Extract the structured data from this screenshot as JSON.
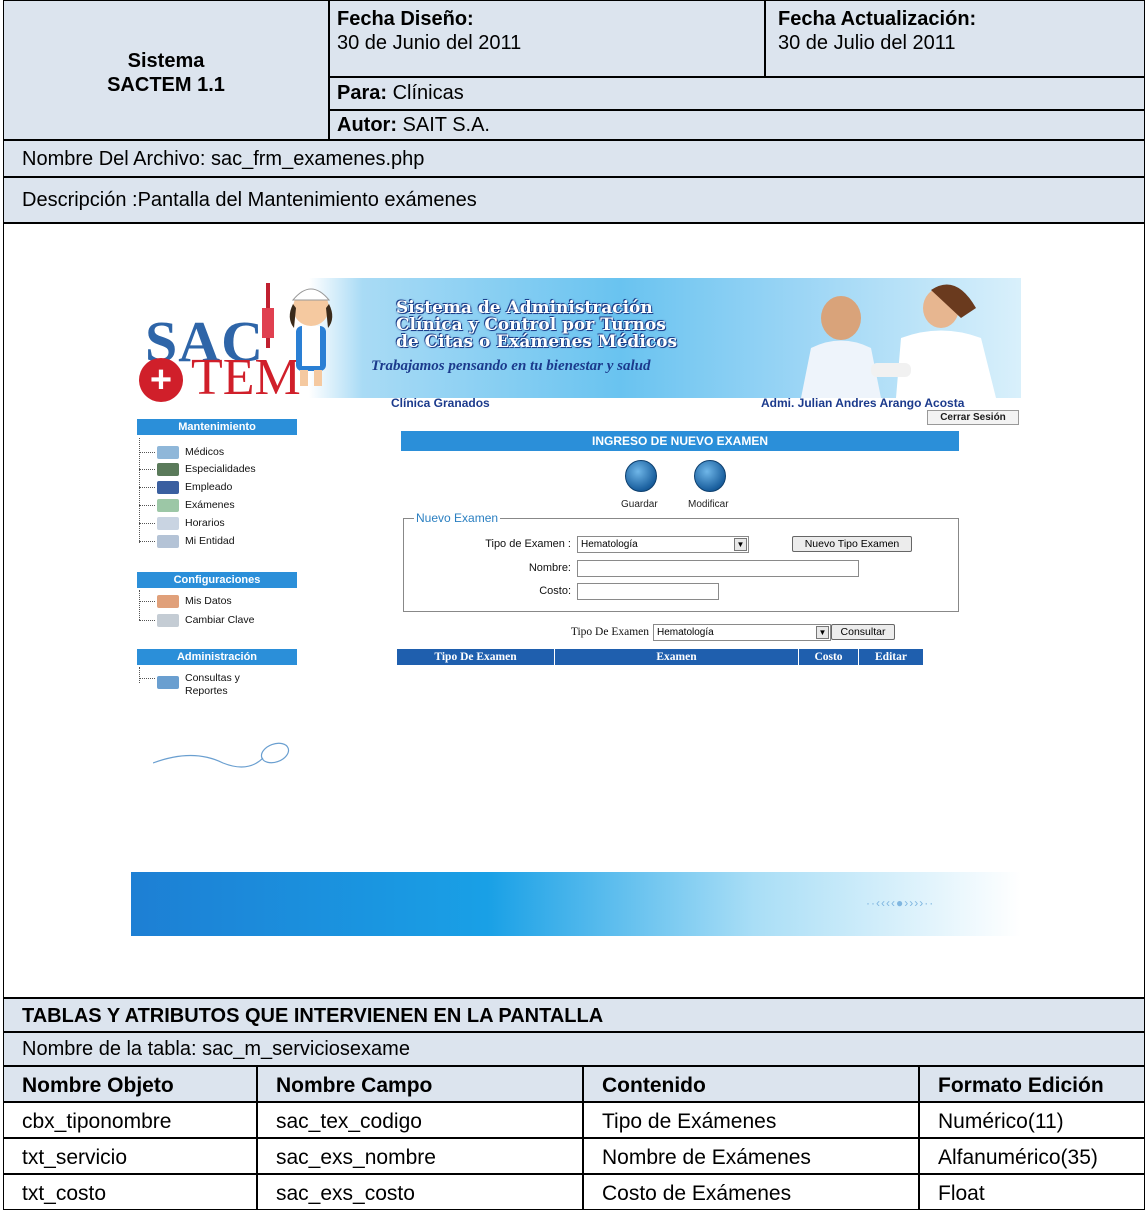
{
  "header": {
    "sistema_line1": "Sistema",
    "sistema_line2": "SACTEM 1.1",
    "fecha_diseno_label": "Fecha Diseño:",
    "fecha_diseno_value": "30 de Junio del 2011",
    "fecha_act_label": "Fecha Actualización:",
    "fecha_act_value": "30 de Julio del 2011",
    "para_label": "Para:",
    "para_value": "Clínicas",
    "autor_label": "Autor:",
    "autor_value": "SAIT S.A."
  },
  "archivo": "Nombre Del Archivo: sac_frm_examenes.php",
  "descripcion": "Descripción :Pantalla del Mantenimiento exámenes",
  "screenshot": {
    "logo_sac": "SAC",
    "logo_tem": "TEM",
    "banner_title": [
      "Sistema de Administración",
      "Clínica y Control por Turnos",
      "de Citas o Exámenes Médicos"
    ],
    "banner_slogan": "Trabajamos pensando en tu bienestar y salud",
    "clinic": "Clínica Granados",
    "admin": "Admi.  Julian Andres Arango Acosta",
    "logout": "Cerrar Sesión",
    "menu": {
      "mantenimiento": "Mantenimiento",
      "mant_items": [
        "Médicos",
        "Especialidades",
        "Empleado",
        "Exámenes",
        "Horarios",
        "Mi Entidad"
      ],
      "configuraciones": "Configuraciones",
      "conf_items": [
        "Mis Datos",
        "Cambiar Clave"
      ],
      "administracion": "Administración",
      "admin_items": [
        "Consultas y",
        "Reportes"
      ]
    },
    "form_title": "INGRESO DE NUEVO EXAMEN",
    "btn_guardar": "Guardar",
    "btn_modificar": "Modificar",
    "legend": "Nuevo Examen",
    "tipo_label": "Tipo de Examen :",
    "tipo_value": "Hematología",
    "nuevo_tipo_btn": "Nuevo Tipo Examen",
    "nombre_label": "Nombre:",
    "costo_label": "Costo:",
    "filter_label": "Tipo De Examen",
    "filter_value": "Hematología",
    "consultar_btn": "Consultar",
    "grid_cols": [
      "Tipo De Examen",
      "Examen",
      "Costo",
      "Editar"
    ]
  },
  "tablas_title": "TABLAS Y ATRIBUTOS QUE INTERVIENEN EN LA PANTALLA",
  "tabla_nombre": "Nombre de la tabla: sac_m_serviciosexame",
  "attr_table": {
    "headers": [
      "Nombre Objeto",
      "Nombre Campo",
      "Contenido",
      "Formato Edición"
    ],
    "rows": [
      [
        "cbx_tiponombre",
        "sac_tex_codigo",
        "Tipo de Exámenes",
        "Numérico(11)"
      ],
      [
        "txt_servicio",
        "sac_exs_nombre",
        "Nombre de Exámenes",
        "Alfanumérico(35)"
      ],
      [
        "txt_costo",
        "sac_exs_costo",
        "Costo de Exámenes",
        "Float"
      ]
    ]
  },
  "colors": {
    "header_gray": "#dce4ee",
    "menu_blue": "#2b8fd9",
    "grid_blue": "#1f5fae"
  }
}
